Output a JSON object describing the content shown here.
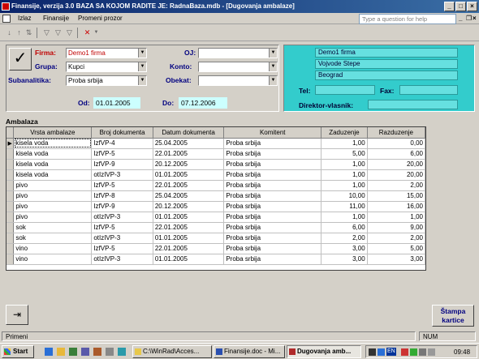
{
  "window": {
    "title": "Finansije, verzija 3.0     BAZA SA KOJOM RADITE JE: RadnaBaza.mdb - [Dugovanja ambalaze]",
    "minimize": "_",
    "maximize": "□",
    "close": "×"
  },
  "menu": {
    "items": [
      "Izlaz",
      "Finansije",
      "Promeni prozor"
    ],
    "help_placeholder": "Type a question for help",
    "doc_min": "_",
    "doc_restore": "❐",
    "doc_close": "×"
  },
  "filters": {
    "firma_label": "Firma:",
    "firma_value": "Demo1 firma",
    "grupa_label": "Grupa:",
    "grupa_value": "Kupci",
    "subanalitika_label": "Subanalitika:",
    "subanalitika_value": "Proba srbija",
    "oj_label": "OJ:",
    "oj_value": "",
    "konto_label": "Konto:",
    "konto_value": "",
    "obekat_label": "Obekat:",
    "obekat_value": "",
    "od_label": "Od:",
    "od_value": "01.01.2005",
    "do_label": "Do:",
    "do_value": "07.12.2006"
  },
  "company": {
    "name": "Demo1 firma",
    "street": "Vojvode Stepe",
    "city": "Beograd",
    "tel_label": "Tel:",
    "tel_value": "",
    "fax_label": "Fax:",
    "fax_value": "",
    "director_label": "Direktor-vlasnik:",
    "director_value": ""
  },
  "grid": {
    "title": "Ambalaza",
    "columns": [
      "Vrsta ambalaze",
      "Broj dokumenta",
      "Datum dokumenta",
      "Komitent",
      "Zaduzenje",
      "Razduzenje"
    ],
    "rows": [
      {
        "vrsta": "kisela voda",
        "broj": "IzfVP-4",
        "datum": "25.04.2005",
        "komitent": "Proba srbija",
        "zad": "1,00",
        "raz": "0,00"
      },
      {
        "vrsta": "kisela voda",
        "broj": "IzfVP-5",
        "datum": "22.01.2005",
        "komitent": "Proba srbija",
        "zad": "5,00",
        "raz": "6,00"
      },
      {
        "vrsta": "kisela voda",
        "broj": "IzfVP-9",
        "datum": "20.12.2005",
        "komitent": "Proba srbija",
        "zad": "1,00",
        "raz": "20,00"
      },
      {
        "vrsta": "kisela voda",
        "broj": "otIzIVP-3",
        "datum": "01.01.2005",
        "komitent": "Proba srbija",
        "zad": "1,00",
        "raz": "20,00"
      },
      {
        "vrsta": "pivo",
        "broj": "IzfVP-5",
        "datum": "22.01.2005",
        "komitent": "Proba srbija",
        "zad": "1,00",
        "raz": "2,00"
      },
      {
        "vrsta": "pivo",
        "broj": "IzfVP-8",
        "datum": "25.04.2005",
        "komitent": "Proba srbija",
        "zad": "10,00",
        "raz": "15,00"
      },
      {
        "vrsta": "pivo",
        "broj": "IzfVP-9",
        "datum": "20.12.2005",
        "komitent": "Proba srbija",
        "zad": "11,00",
        "raz": "16,00"
      },
      {
        "vrsta": "pivo",
        "broj": "otIzIVP-3",
        "datum": "01.01.2005",
        "komitent": "Proba srbija",
        "zad": "1,00",
        "raz": "1,00"
      },
      {
        "vrsta": "sok",
        "broj": "IzfVP-5",
        "datum": "22.01.2005",
        "komitent": "Proba srbija",
        "zad": "6,00",
        "raz": "9,00"
      },
      {
        "vrsta": "sok",
        "broj": "otIzIVP-3",
        "datum": "01.01.2005",
        "komitent": "Proba srbija",
        "zad": "2,00",
        "raz": "2,00"
      },
      {
        "vrsta": "vino",
        "broj": "IzfVP-5",
        "datum": "22.01.2005",
        "komitent": "Proba srbija",
        "zad": "3,00",
        "raz": "5,00"
      },
      {
        "vrsta": "vino",
        "broj": "otIzIVP-3",
        "datum": "01.01.2005",
        "komitent": "Proba srbija",
        "zad": "3,00",
        "raz": "3,00"
      }
    ]
  },
  "buttons": {
    "print_label_1": "Štampa",
    "print_label_2": "kartice"
  },
  "status": {
    "left": "Primeni",
    "right": "NUM"
  },
  "taskbar": {
    "start": "Start",
    "tasks": [
      "C:\\WinRad\\Acces...",
      "Finansije.doc - Mi...",
      "Dugovanja amb..."
    ],
    "lang": "EN",
    "clock": "09:48"
  },
  "colors": {
    "accent_teal": "#33cccc",
    "date_bg": "#ccffff",
    "label_red": "#c00000",
    "label_blue": "#000080"
  }
}
